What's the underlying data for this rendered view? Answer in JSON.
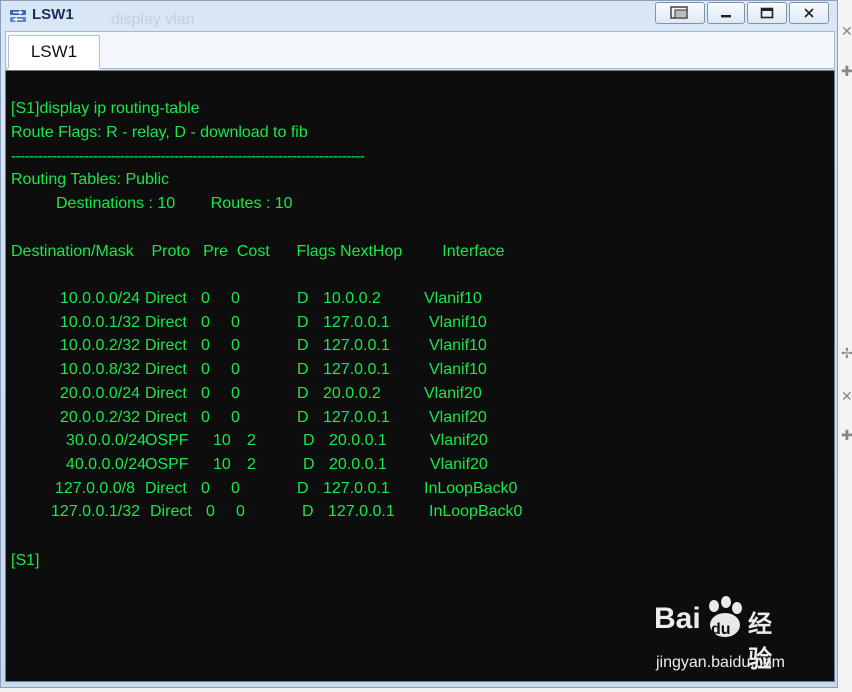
{
  "window": {
    "title": "LSW1",
    "background_ghost_text": "display  vlan"
  },
  "tabs": [
    {
      "label": "LSW1",
      "active": true
    }
  ],
  "terminal": {
    "text_color": "#17e84a",
    "background": "#0d0d0d",
    "lines": [
      "[S1]display ip routing-table",
      "Route Flags: R - relay, D - download to fib",
      "------------------------------------------------------------------------------",
      "Routing Tables: Public",
      "Destinations : 10        Routes : 10",
      "Destination/Mask    Proto   Pre  Cost      Flags NextHop         Interface",
      "[S1]"
    ],
    "routes": [
      {
        "dest": "10.0.0.0/24",
        "proto": "Direct",
        "pre": "0",
        "cost": "0",
        "flags": "D",
        "nexthop": "10.0.0.2",
        "iface": "Vlanif10"
      },
      {
        "dest": "10.0.0.1/32",
        "proto": "Direct",
        "pre": "0",
        "cost": "0",
        "flags": "D",
        "nexthop": "127.0.0.1",
        "iface": "Vlanif10"
      },
      {
        "dest": "10.0.0.2/32",
        "proto": "Direct",
        "pre": "0",
        "cost": "0",
        "flags": "D",
        "nexthop": "127.0.0.1",
        "iface": "Vlanif10"
      },
      {
        "dest": "10.0.0.8/32",
        "proto": "Direct",
        "pre": "0",
        "cost": "0",
        "flags": "D",
        "nexthop": "127.0.0.1",
        "iface": "Vlanif10"
      },
      {
        "dest": "20.0.0.0/24",
        "proto": "Direct",
        "pre": "0",
        "cost": "0",
        "flags": "D",
        "nexthop": "20.0.0.2",
        "iface": "Vlanif20"
      },
      {
        "dest": "20.0.0.2/32",
        "proto": "Direct",
        "pre": "0",
        "cost": "0",
        "flags": "D",
        "nexthop": "127.0.0.1",
        "iface": "Vlanif20"
      },
      {
        "dest": "30.0.0.0/24",
        "proto": "OSPF",
        "pre": "10",
        "cost": "2",
        "flags": "D",
        "nexthop": "20.0.0.1",
        "iface": "Vlanif20"
      },
      {
        "dest": "40.0.0.0/24",
        "proto": "OSPF",
        "pre": "10",
        "cost": "2",
        "flags": "D",
        "nexthop": "20.0.0.1",
        "iface": "Vlanif20"
      },
      {
        "dest": "127.0.0.0/8",
        "proto": "Direct",
        "pre": "0",
        "cost": "0",
        "flags": "D",
        "nexthop": "127.0.0.1",
        "iface": "InLoopBack0"
      },
      {
        "dest": "127.0.0.1/32",
        "proto": "Direct",
        "pre": "0",
        "cost": "0",
        "flags": "D",
        "nexthop": "127.0.0.1",
        "iface": "InLoopBack0"
      }
    ]
  },
  "watermark": {
    "brand": "Bai",
    "brand_cn": "经验",
    "paw_text": "du",
    "url": "jingyan.baidu.com"
  },
  "icons": {
    "app": "switch-icon",
    "restore": "restore-window-icon",
    "minimize": "minimize-icon",
    "maximize": "maximize-icon",
    "close": "close-icon"
  }
}
